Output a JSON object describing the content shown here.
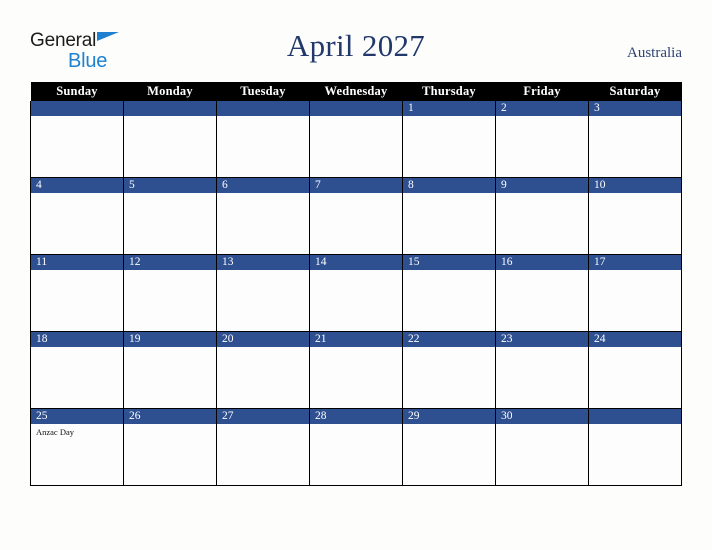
{
  "brand": {
    "name_part1": "General",
    "name_part2": "Blue",
    "triangle_color": "#1f7fd0"
  },
  "header": {
    "title": "April 2027",
    "region": "Australia"
  },
  "theme": {
    "header_bg": "#000000",
    "header_text": "#ffffff",
    "date_bar_bg": "#2e5090",
    "date_text": "#ffffff",
    "title_color": "#22386b",
    "page_bg": "#fdfdfc"
  },
  "calendar": {
    "weekday_headers": [
      "Sunday",
      "Monday",
      "Tuesday",
      "Wednesday",
      "Thursday",
      "Friday",
      "Saturday"
    ],
    "weeks": [
      [
        {
          "date": "",
          "events": []
        },
        {
          "date": "",
          "events": []
        },
        {
          "date": "",
          "events": []
        },
        {
          "date": "",
          "events": []
        },
        {
          "date": "1",
          "events": []
        },
        {
          "date": "2",
          "events": []
        },
        {
          "date": "3",
          "events": []
        }
      ],
      [
        {
          "date": "4",
          "events": []
        },
        {
          "date": "5",
          "events": []
        },
        {
          "date": "6",
          "events": []
        },
        {
          "date": "7",
          "events": []
        },
        {
          "date": "8",
          "events": []
        },
        {
          "date": "9",
          "events": []
        },
        {
          "date": "10",
          "events": []
        }
      ],
      [
        {
          "date": "11",
          "events": []
        },
        {
          "date": "12",
          "events": []
        },
        {
          "date": "13",
          "events": []
        },
        {
          "date": "14",
          "events": []
        },
        {
          "date": "15",
          "events": []
        },
        {
          "date": "16",
          "events": []
        },
        {
          "date": "17",
          "events": []
        }
      ],
      [
        {
          "date": "18",
          "events": []
        },
        {
          "date": "19",
          "events": []
        },
        {
          "date": "20",
          "events": []
        },
        {
          "date": "21",
          "events": []
        },
        {
          "date": "22",
          "events": []
        },
        {
          "date": "23",
          "events": []
        },
        {
          "date": "24",
          "events": []
        }
      ],
      [
        {
          "date": "25",
          "events": [
            "Anzac Day"
          ]
        },
        {
          "date": "26",
          "events": []
        },
        {
          "date": "27",
          "events": []
        },
        {
          "date": "28",
          "events": []
        },
        {
          "date": "29",
          "events": []
        },
        {
          "date": "30",
          "events": []
        },
        {
          "date": "",
          "events": []
        }
      ]
    ]
  }
}
